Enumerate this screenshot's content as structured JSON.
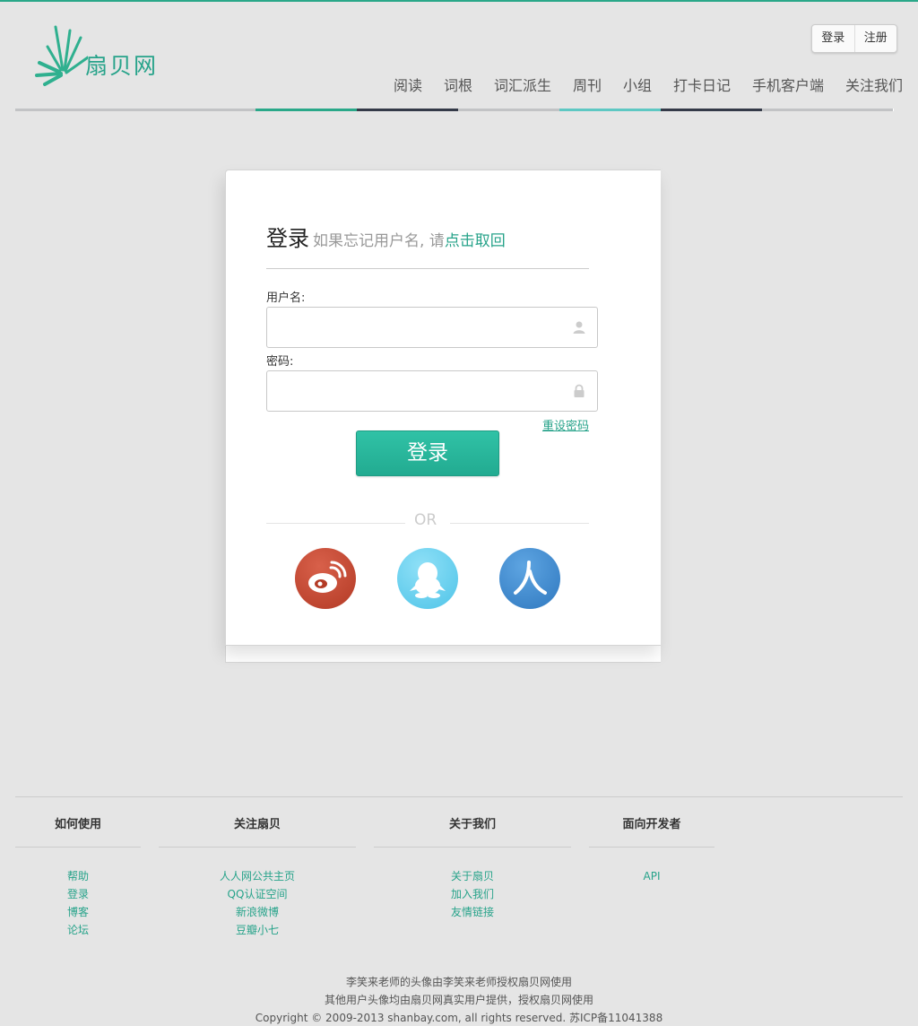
{
  "colors": {
    "accent": "#27a38a",
    "dark_bar": "#343a48",
    "teal_bar": "#5ec8c3",
    "gray_bar": "#c2c3c5"
  },
  "header": {
    "logo_text": "扇贝网",
    "auth": {
      "login": "登录",
      "register": "注册"
    },
    "nav": [
      "阅读",
      "词根",
      "词汇派生",
      "周刊",
      "小组",
      "打卡日记",
      "手机客户端",
      "关注我们"
    ]
  },
  "login_card": {
    "title": "登录",
    "hint_prefix": "如果忘记用户名, 请",
    "hint_link": "点击取回",
    "username_label": "用户名:",
    "password_label": "密码:",
    "reset_link": "重设密码",
    "submit_label": "登录",
    "or_text": "OR",
    "social": [
      {
        "name": "weibo",
        "icon": "weibo-icon",
        "color": "#c54a32"
      },
      {
        "name": "qq",
        "icon": "qq-penguin-icon",
        "color": "#6dd2ef"
      },
      {
        "name": "renren",
        "icon": "renren-icon",
        "color": "#3f8ed3"
      }
    ]
  },
  "footer": {
    "columns": [
      {
        "title": "如何使用",
        "links": [
          "帮助",
          "登录",
          "博客",
          "论坛"
        ]
      },
      {
        "title": "关注扇贝",
        "links": [
          "人人网公共主页",
          "QQ认证空间",
          "新浪微博",
          "豆瓣小七"
        ]
      },
      {
        "title": "关于我们",
        "links": [
          "关于扇贝",
          "加入我们",
          "友情链接"
        ]
      },
      {
        "title": "面向开发者",
        "links": [
          "API"
        ]
      }
    ],
    "credit_line_1": "李笑来老师的头像由李笑来老师授权扇贝网使用",
    "credit_line_2": "其他用户头像均由扇贝网真实用户提供，授权扇贝网使用",
    "copyright": "Copyright © 2009-2013 shanbay.com, all rights reserved. 苏ICP备11041388"
  }
}
